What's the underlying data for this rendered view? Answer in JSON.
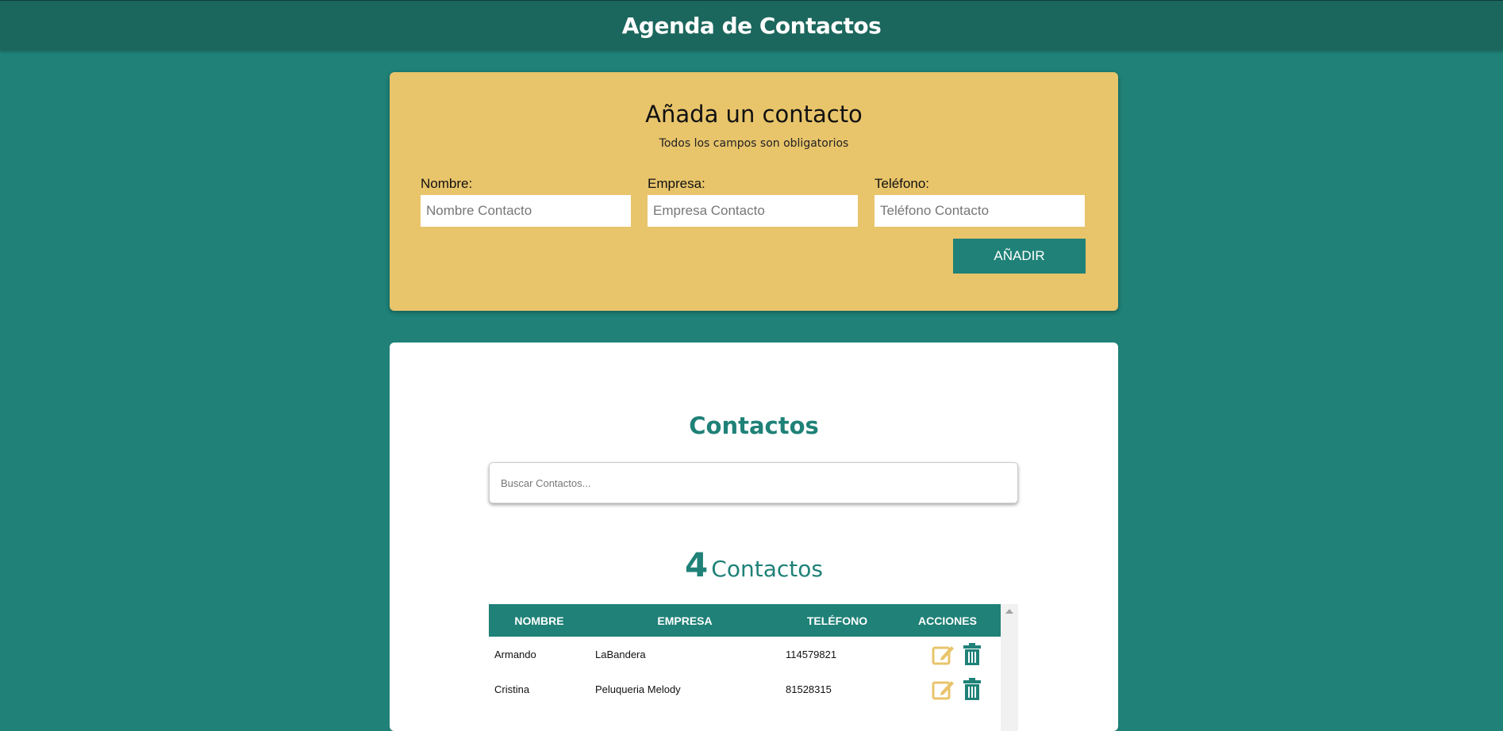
{
  "header": {
    "title": "Agenda de Contactos"
  },
  "form": {
    "title": "Añada un contacto",
    "subtitle": "Todos los campos son obligatorios",
    "fields": [
      {
        "label": "Nombre:",
        "placeholder": "Nombre Contacto"
      },
      {
        "label": "Empresa:",
        "placeholder": "Empresa Contacto"
      },
      {
        "label": "Teléfono:",
        "placeholder": "Teléfono Contacto"
      }
    ],
    "submit_label": "AÑADIR"
  },
  "contacts": {
    "title": "Contactos",
    "search_placeholder": "Buscar Contactos...",
    "count": "4",
    "count_label": "Contactos",
    "columns": [
      "NOMBRE",
      "EMPRESA",
      "TELÉFONO",
      "ACCIONES"
    ],
    "rows": [
      {
        "nombre": "Armando",
        "empresa": "LaBandera",
        "telefono": "114579821"
      },
      {
        "nombre": "Cristina",
        "empresa": "Peluqueria Melody",
        "telefono": "81528315"
      }
    ]
  },
  "colors": {
    "primary": "#1f8177",
    "accent": "#e8c46b",
    "header": "#1c675d"
  },
  "icons": {
    "edit": "edit-icon",
    "delete": "trash-icon"
  }
}
